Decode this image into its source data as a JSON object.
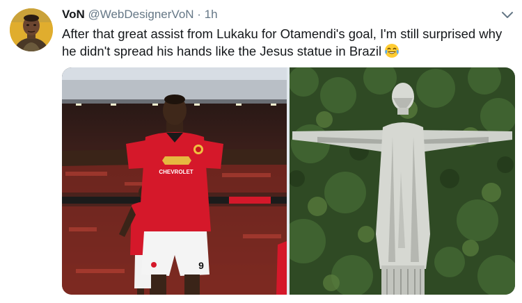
{
  "tweet": {
    "display_name": "VoN",
    "handle": "@WebDesignerVoN",
    "separator": "·",
    "time": "1h",
    "text": "After that great assist from Lukaku for Otamendi's goal, I'm still surprised why he didn't spread his hands like the Jesus statue in Brazil",
    "emoji": "face-with-tears-of-joy"
  },
  "icons": {
    "avatar": "user-avatar",
    "menu": "chevron-down-icon"
  },
  "media": {
    "left_jersey_sponsor": "CHEVROLET",
    "left_shorts_number": "9"
  },
  "colors": {
    "name": "#14171a",
    "secondary": "#657786",
    "text": "#14171a",
    "jersey_red": "#d5182a"
  }
}
